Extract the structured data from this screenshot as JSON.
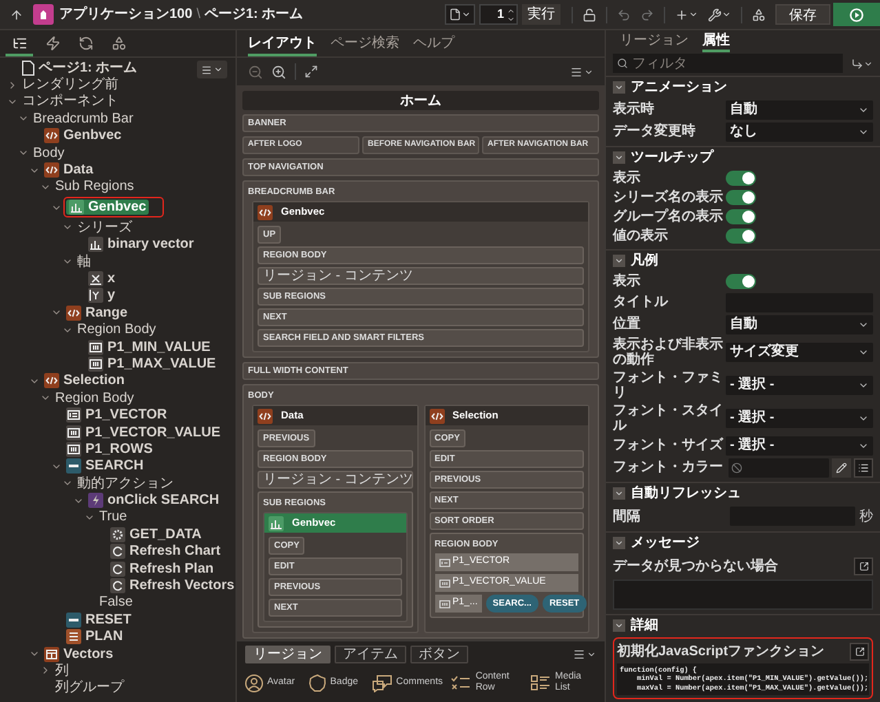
{
  "header": {
    "app": "アプリケーション100",
    "separator": "\\",
    "page": "ページ1: ホーム",
    "page_number": "1",
    "run_button": "実行",
    "save_button": "保存"
  },
  "left_tabs": [
    {
      "kind": "tree",
      "selected": true
    },
    {
      "kind": "dynamic",
      "selected": false
    },
    {
      "kind": "process",
      "selected": false
    },
    {
      "kind": "shared",
      "selected": false
    }
  ],
  "tree": [
    {
      "label": "ページ1: ホーム",
      "kind": "page",
      "selected": false,
      "highlighted": false
    },
    {
      "label": "レンダリング前",
      "kind": "group",
      "selected": false,
      "highlighted": false,
      "expanded": false
    },
    {
      "label": "コンポーネント",
      "kind": "group",
      "selected": false,
      "highlighted": false,
      "expanded": true,
      "children": [
        {
          "label": "Breadcrumb Bar",
          "kind": "group",
          "selected": false,
          "highlighted": false,
          "expanded": true,
          "children": [
            {
              "label": "Genbvec",
              "kind": "region",
              "selected": false,
              "highlighted": false
            }
          ]
        },
        {
          "label": "Body",
          "kind": "group",
          "selected": false,
          "highlighted": false,
          "expanded": true,
          "children": [
            {
              "label": "Data",
              "kind": "region",
              "selected": false,
              "highlighted": false,
              "expanded": true,
              "children": [
                {
                  "label": "Sub Regions",
                  "kind": "group",
                  "selected": false,
                  "highlighted": false,
                  "expanded": true,
                  "children": [
                    {
                      "label": "Genbvec",
                      "kind": "chart",
                      "selected": true,
                      "highlighted": true,
                      "expanded": true,
                      "children": [
                        {
                          "label": "シリーズ",
                          "kind": "group",
                          "selected": false,
                          "highlighted": false,
                          "expanded": true,
                          "children": [
                            {
                              "label": "binary vector",
                              "kind": "series",
                              "selected": false,
                              "highlighted": false
                            }
                          ]
                        },
                        {
                          "label": "軸",
                          "kind": "group",
                          "selected": false,
                          "highlighted": false,
                          "expanded": true,
                          "children": [
                            {
                              "label": "x",
                              "kind": "axis_x",
                              "selected": false,
                              "highlighted": false
                            },
                            {
                              "label": "y",
                              "kind": "axis_y",
                              "selected": false,
                              "highlighted": false
                            }
                          ]
                        }
                      ]
                    },
                    {
                      "label": "Range",
                      "kind": "region",
                      "selected": false,
                      "highlighted": false,
                      "expanded": true,
                      "children": [
                        {
                          "label": "Region Body",
                          "kind": "group",
                          "selected": false,
                          "highlighted": false,
                          "expanded": true,
                          "children": [
                            {
                              "label": "P1_MIN_VALUE",
                              "kind": "number_item",
                              "selected": false,
                              "highlighted": false
                            },
                            {
                              "label": "P1_MAX_VALUE",
                              "kind": "number_item",
                              "selected": false,
                              "highlighted": false
                            }
                          ]
                        }
                      ]
                    }
                  ]
                }
              ]
            },
            {
              "label": "Selection",
              "kind": "region",
              "selected": false,
              "highlighted": false,
              "expanded": true,
              "children": [
                {
                  "label": "Region Body",
                  "kind": "group",
                  "selected": false,
                  "highlighted": false,
                  "expanded": true,
                  "children": [
                    {
                      "label": "P1_VECTOR",
                      "kind": "text_item",
                      "selected": false,
                      "highlighted": false
                    },
                    {
                      "label": "P1_VECTOR_VALUE",
                      "kind": "number_item",
                      "selected": false,
                      "highlighted": false
                    },
                    {
                      "label": "P1_ROWS",
                      "kind": "number_item",
                      "selected": false,
                      "highlighted": false
                    },
                    {
                      "label": "SEARCH",
                      "kind": "button",
                      "selected": false,
                      "highlighted": false,
                      "expanded": true,
                      "children": [
                        {
                          "label": "動的アクション",
                          "kind": "group",
                          "selected": false,
                          "highlighted": false,
                          "expanded": true,
                          "children": [
                            {
                              "label": "onClick SEARCH",
                              "kind": "dynamic_action",
                              "selected": false,
                              "highlighted": false,
                              "expanded": true,
                              "children": [
                                {
                                  "label": "True",
                                  "kind": "group",
                                  "selected": false,
                                  "highlighted": false,
                                  "expanded": true,
                                  "children": [
                                    {
                                      "label": "GET_DATA",
                                      "kind": "plsql",
                                      "selected": false,
                                      "highlighted": false
                                    },
                                    {
                                      "label": "Refresh Chart",
                                      "kind": "refresh",
                                      "selected": false,
                                      "highlighted": false
                                    },
                                    {
                                      "label": "Refresh Plan",
                                      "kind": "refresh",
                                      "selected": false,
                                      "highlighted": false
                                    },
                                    {
                                      "label": "Refresh Vectors",
                                      "kind": "refresh",
                                      "selected": false,
                                      "highlighted": false
                                    }
                                  ]
                                },
                                {
                                  "label": "False",
                                  "kind": "group",
                                  "selected": false,
                                  "highlighted": false
                                }
                              ]
                            }
                          ]
                        }
                      ]
                    },
                    {
                      "label": "RESET",
                      "kind": "button",
                      "selected": false,
                      "highlighted": false
                    },
                    {
                      "label": "PLAN",
                      "kind": "plan",
                      "selected": false,
                      "highlighted": false
                    }
                  ]
                }
              ]
            },
            {
              "label": "Vectors",
              "kind": "report",
              "selected": false,
              "highlighted": false,
              "expanded": true,
              "children": [
                {
                  "label": "列",
                  "kind": "group",
                  "selected": false,
                  "highlighted": false,
                  "expanded": false
                },
                {
                  "label": "列グループ",
                  "kind": "group",
                  "selected": false,
                  "highlighted": false
                }
              ]
            }
          ]
        }
      ]
    }
  ],
  "center": {
    "tabs": [
      {
        "label": "レイアウト",
        "selected": true
      },
      {
        "label": "ページ検索",
        "selected": false
      },
      {
        "label": "ヘルプ",
        "selected": false
      }
    ],
    "canvas": {
      "title": "ホーム",
      "positions": [
        {
          "kind": "slot",
          "label": "BANNER"
        },
        {
          "kind": "columns",
          "cells": [
            {
              "label": "AFTER LOGO"
            },
            {
              "label": "BEFORE NAVIGATION BAR"
            },
            {
              "label": "AFTER NAVIGATION BAR"
            }
          ]
        },
        {
          "kind": "slot",
          "label": "TOP NAVIGATION"
        },
        {
          "kind": "area",
          "label": "BREADCRUMB BAR",
          "regions": [
            {
              "title": "Genbvec",
              "kind": "static",
              "selected": false,
              "slots": [
                {
                  "kind": "short",
                  "label": "UP"
                },
                {
                  "kind": "slot",
                  "label": "REGION BODY"
                },
                {
                  "kind": "content",
                  "label": "リージョン - コンテンツ"
                },
                {
                  "kind": "slot",
                  "label": "SUB REGIONS"
                },
                {
                  "kind": "slot",
                  "label": "NEXT"
                },
                {
                  "kind": "slot",
                  "label": "SEARCH FIELD AND SMART FILTERS"
                }
              ]
            }
          ]
        },
        {
          "kind": "slot",
          "label": "FULL WIDTH CONTENT"
        },
        {
          "kind": "area",
          "label": "BODY",
          "regions": [
            {
              "title": "Data",
              "kind": "static",
              "selected": false,
              "slots": [
                {
                  "kind": "short",
                  "label": "PREVIOUS"
                },
                {
                  "kind": "slot",
                  "label": "REGION BODY"
                },
                {
                  "kind": "content",
                  "label": "リージョン - コンテンツ"
                },
                {
                  "kind": "container",
                  "label": "SUB REGIONS",
                  "regions": [
                    {
                      "title": "Genbvec",
                      "kind": "chart",
                      "selected": true,
                      "slots": [
                        {
                          "kind": "short",
                          "label": "COPY"
                        },
                        {
                          "kind": "slot",
                          "label": "EDIT"
                        },
                        {
                          "kind": "slot",
                          "label": "PREVIOUS"
                        },
                        {
                          "kind": "slot",
                          "label": "NEXT"
                        }
                      ]
                    }
                  ]
                }
              ]
            },
            {
              "title": "Selection",
              "kind": "static",
              "selected": false,
              "slots": [
                {
                  "kind": "short",
                  "label": "COPY"
                },
                {
                  "kind": "slot",
                  "label": "EDIT"
                },
                {
                  "kind": "slot",
                  "label": "PREVIOUS"
                },
                {
                  "kind": "slot",
                  "label": "NEXT"
                },
                {
                  "kind": "slot",
                  "label": "SORT ORDER"
                },
                {
                  "kind": "container",
                  "label": "REGION BODY",
                  "rows": [
                    [
                      {
                        "kind": "text_item",
                        "label": "P1_VECTOR"
                      }
                    ],
                    [
                      {
                        "kind": "number_item",
                        "label": "P1_VECTOR_VALUE"
                      }
                    ],
                    [
                      {
                        "kind": "number_item",
                        "label": "P1_..."
                      },
                      {
                        "kind": "button",
                        "label": "SEARC..."
                      },
                      {
                        "kind": "button",
                        "label": "RESET"
                      }
                    ]
                  ]
                }
              ]
            }
          ]
        }
      ]
    },
    "gallery": {
      "tabs": [
        {
          "label": "リージョン",
          "selected": true
        },
        {
          "label": "アイテム",
          "selected": false
        },
        {
          "label": "ボタン",
          "selected": false
        }
      ],
      "items": [
        {
          "kind": "avatar",
          "label": "Avatar"
        },
        {
          "kind": "badge",
          "label": "Badge"
        },
        {
          "kind": "comments",
          "label": "Comments"
        },
        {
          "kind": "content_row",
          "label": "Content Row"
        },
        {
          "kind": "media_list",
          "label": "Media List"
        }
      ]
    }
  },
  "right": {
    "tabs": [
      {
        "label": "リージョン",
        "selected": false
      },
      {
        "label": "属性",
        "selected": true
      }
    ],
    "filter": {
      "placeholder": "フィルタ"
    },
    "sections": [
      {
        "title": "アニメーション",
        "expanded": true,
        "rows": [
          {
            "kind": "select",
            "label": "表示時",
            "value": "自動"
          },
          {
            "kind": "select",
            "label": "データ変更時",
            "value": "なし"
          }
        ]
      },
      {
        "title": "ツールチップ",
        "expanded": true,
        "rows": [
          {
            "kind": "toggle",
            "label": "表示",
            "on": true
          },
          {
            "kind": "toggle",
            "label": "シリーズ名の表示",
            "on": true
          },
          {
            "kind": "toggle",
            "label": "グループ名の表示",
            "on": true
          },
          {
            "kind": "toggle",
            "label": "値の表示",
            "on": true
          }
        ]
      },
      {
        "title": "凡例",
        "expanded": true,
        "rows": [
          {
            "kind": "toggle",
            "label": "表示",
            "on": true
          },
          {
            "kind": "text",
            "label": "タイトル"
          },
          {
            "kind": "select",
            "label": "位置",
            "value": "自動"
          },
          {
            "kind": "select",
            "label": "表示および非表示の動作",
            "value": "サイズ変更"
          },
          {
            "kind": "select",
            "label": "フォント・ファミリ",
            "value": "- 選択 -"
          },
          {
            "kind": "select",
            "label": "フォント・スタイル",
            "value": "- 選択 -"
          },
          {
            "kind": "select",
            "label": "フォント・サイズ",
            "value": "- 選択 -"
          },
          {
            "kind": "color",
            "label": "フォント・カラー"
          }
        ]
      },
      {
        "title": "自動リフレッシュ",
        "expanded": true,
        "rows": [
          {
            "kind": "number",
            "label": "間隔",
            "suffix": "秒"
          }
        ]
      },
      {
        "title": "メッセージ",
        "expanded": true,
        "rows": [
          {
            "kind": "textarea",
            "label": "データが見つからない場合"
          }
        ]
      },
      {
        "title": "詳細",
        "expanded": true,
        "rows": [
          {
            "kind": "code",
            "label": "初期化JavaScriptファンクション",
            "highlighted": true,
            "lines": [
              "function(config) {",
              "    minVal = Number(apex.item(\"P1_MIN_VALUE\").getValue());",
              "    maxVal = Number(apex.item(\"P1_MAX_VALUE\").getValue());"
            ]
          }
        ]
      }
    ]
  }
}
